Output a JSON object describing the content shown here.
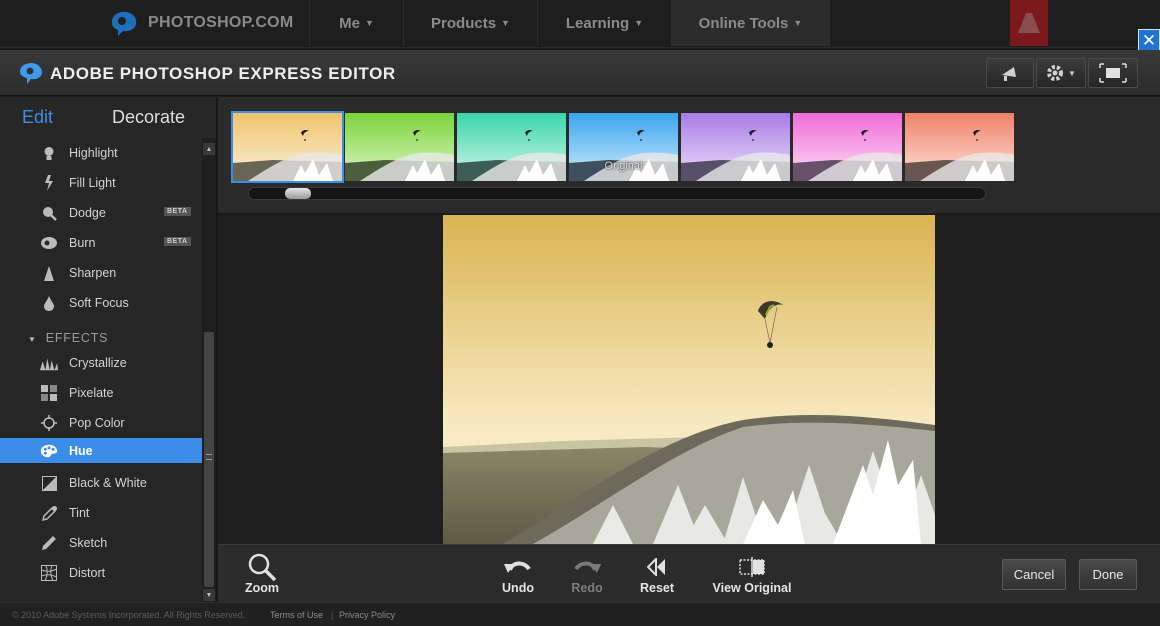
{
  "site_nav": {
    "brand": "PHOTOSHOP.COM",
    "items": [
      {
        "label": "Me"
      },
      {
        "label": "Products"
      },
      {
        "label": "Learning"
      },
      {
        "label": "Online Tools"
      }
    ]
  },
  "title_bar": {
    "title": "ADOBE PHOTOSHOP EXPRESS EDITOR"
  },
  "left_panel": {
    "tabs": {
      "edit": "Edit",
      "decorate": "Decorate"
    },
    "tools": [
      {
        "label": "Highlight",
        "icon": "bulb-icon"
      },
      {
        "label": "Fill Light",
        "icon": "lightning-icon"
      },
      {
        "label": "Dodge",
        "icon": "magnifier-icon",
        "badge": "BETA"
      },
      {
        "label": "Burn",
        "icon": "flame-icon",
        "badge": "BETA"
      },
      {
        "label": "Sharpen",
        "icon": "cone-icon"
      },
      {
        "label": "Soft Focus",
        "icon": "drop-icon"
      }
    ],
    "effects_header": "EFFECTS",
    "effects": [
      {
        "label": "Crystallize",
        "icon": "crystal-icon"
      },
      {
        "label": "Pixelate",
        "icon": "grid-icon"
      },
      {
        "label": "Pop Color",
        "icon": "crosshair-icon"
      },
      {
        "label": "Hue",
        "icon": "palette-icon",
        "selected": true
      },
      {
        "label": "Black & White",
        "icon": "bw-square-icon"
      },
      {
        "label": "Tint",
        "icon": "dropper-icon"
      },
      {
        "label": "Sketch",
        "icon": "pencil-icon"
      },
      {
        "label": "Distort",
        "icon": "distort-icon"
      }
    ]
  },
  "thumbnails": [
    {
      "sky_top": "#f0c36a",
      "sky_bottom": "#fbf2dd",
      "ground": "#6a6656",
      "selected": true,
      "label": ""
    },
    {
      "sky_top": "#79d33a",
      "sky_bottom": "#e0f7c8",
      "ground": "#4c5e3c",
      "label": ""
    },
    {
      "sky_top": "#39d6a8",
      "sky_bottom": "#d4f5ea",
      "ground": "#3d5e55",
      "label": ""
    },
    {
      "sky_top": "#3aa5ee",
      "sky_bottom": "#d2ecff",
      "ground": "#3f4f60",
      "label": "Original"
    },
    {
      "sky_top": "#a77be6",
      "sky_bottom": "#ece1fb",
      "ground": "#58506a",
      "label": ""
    },
    {
      "sky_top": "#f06bd8",
      "sky_bottom": "#fde1f5",
      "ground": "#69506a",
      "label": ""
    },
    {
      "sky_top": "#f0826a",
      "sky_bottom": "#fde2d8",
      "ground": "#6a5550",
      "label": ""
    }
  ],
  "thumbnail_scroll": {
    "position": 0.05
  },
  "bottom_toolbar": {
    "zoom": "Zoom",
    "undo": "Undo",
    "redo": "Redo",
    "reset": "Reset",
    "view_original": "View Original",
    "cancel": "Cancel",
    "done": "Done"
  },
  "footer": {
    "copyright": "© 2010 Adobe Systems Incorporated. All Rights Reserved.",
    "terms": "Terms of Use",
    "separator": "|",
    "privacy": "Privacy Policy"
  },
  "colors": {
    "accent": "#3b8de8",
    "photo_sky_top": "#d9b451",
    "photo_sky_bottom": "#fdf6e2"
  }
}
